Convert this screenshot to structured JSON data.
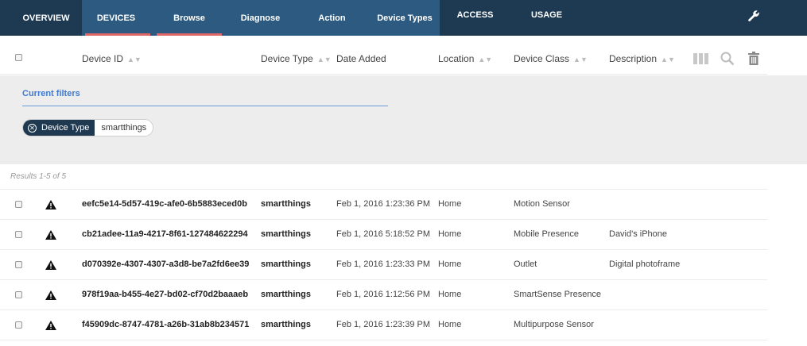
{
  "nav": {
    "overview": "OVERVIEW",
    "devices": "DEVICES",
    "browse": "Browse",
    "diagnose": "Diagnose",
    "action": "Action",
    "device_types": "Device Types",
    "access": "ACCESS",
    "usage": "USAGE",
    "settings_icon": "wrench-icon"
  },
  "columns": {
    "device_id": "Device ID",
    "device_type": "Device Type",
    "date_added": "Date Added",
    "location": "Location",
    "device_class": "Device Class",
    "description": "Description"
  },
  "filters": {
    "title": "Current filters",
    "chip_key": "Device Type",
    "chip_value": "smartthings"
  },
  "results": {
    "summary": "Results 1-5 of 5",
    "rows": [
      {
        "id": "eefc5e14-5d57-419c-afe0-6b5883eced0b",
        "type": "smartthings",
        "date": "Feb 1, 2016 1:23:36 PM",
        "location": "Home",
        "class": "Motion Sensor",
        "description": ""
      },
      {
        "id": "cb21adee-11a9-4217-8f61-127484622294",
        "type": "smartthings",
        "date": "Feb 1, 2016 5:18:52 PM",
        "location": "Home",
        "class": "Mobile Presence",
        "description": "David's iPhone"
      },
      {
        "id": "d070392e-4307-4307-a3d8-be7a2fd6ee39",
        "type": "smartthings",
        "date": "Feb 1, 2016 1:23:33 PM",
        "location": "Home",
        "class": "Outlet",
        "description": "Digital photoframe"
      },
      {
        "id": "978f19aa-b455-4e27-bd02-cf70d2baaaeb",
        "type": "smartthings",
        "date": "Feb 1, 2016 1:12:56 PM",
        "location": "Home",
        "class": "SmartSense Presence",
        "description": ""
      },
      {
        "id": "f45909dc-8747-4781-a26b-31ab8b234571",
        "type": "smartthings",
        "date": "Feb 1, 2016 1:23:39 PM",
        "location": "Home",
        "class": "Multipurpose Sensor",
        "description": ""
      }
    ]
  },
  "colors": {
    "nav_bg": "#1e3a52",
    "nav_sub_bg": "#2d5a80",
    "active_bar": "#e06768",
    "filter_accent": "#3f7bd0"
  }
}
